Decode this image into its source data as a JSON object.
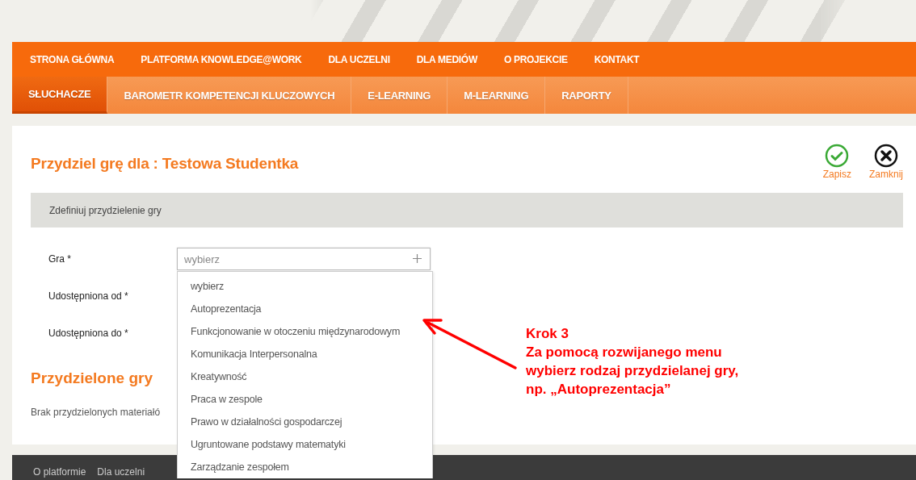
{
  "top_nav": [
    {
      "label": "STRONA GŁÓWNA"
    },
    {
      "label": "PLATFORMA KNOWLEDGE@WORK"
    },
    {
      "label": "DLA UCZELNI"
    },
    {
      "label": "DLA MEDIÓW"
    },
    {
      "label": "O PROJEKCIE"
    },
    {
      "label": "KONTAKT"
    }
  ],
  "sub_nav": [
    {
      "label": "SŁUCHACZE",
      "selected": true
    },
    {
      "label": "BAROMETR KOMPETENCJI KLUCZOWYCH",
      "selected": false
    },
    {
      "label": "E-LEARNING",
      "selected": false
    },
    {
      "label": "M-LEARNING",
      "selected": false
    },
    {
      "label": "RAPORTY",
      "selected": false
    }
  ],
  "page": {
    "title": "Przydziel grę dla : Testowa Studentka",
    "actions": [
      {
        "kind": "save",
        "label": "Zapisz"
      },
      {
        "kind": "close",
        "label": "Zamknij"
      }
    ],
    "section": "Zdefiniuj przydzielenie gry",
    "fields": [
      {
        "kind": "select",
        "label": "Gra *",
        "placeholder": "wybierz",
        "expanded": true,
        "options": [
          "wybierz",
          "Autoprezentacja",
          "Funkcjonowanie w otoczeniu międzynarodowym",
          "Komunikacja Interpersonalna",
          "Kreatywność",
          "Praca w zespole",
          "Prawo w działalności gospodarczej",
          "Ugruntowane podstawy matematyki",
          "Zarządzanie zespołem"
        ]
      },
      {
        "kind": "date",
        "label": "Udostępniona od *"
      },
      {
        "kind": "date",
        "label": "Udostępniona do *"
      }
    ],
    "assigned_title": "Przydzielone gry",
    "empty_text": "Brak przydzielonych materiałó"
  },
  "footer": {
    "links": [
      "O platformie",
      "Dla uczelni"
    ]
  },
  "annotation": {
    "lines": [
      "Krok 3",
      "Za pomocą rozwijanego menu",
      "wybierz  rodzaj przydzielanej gry,",
      "np. „Autoprezentacja”"
    ]
  }
}
